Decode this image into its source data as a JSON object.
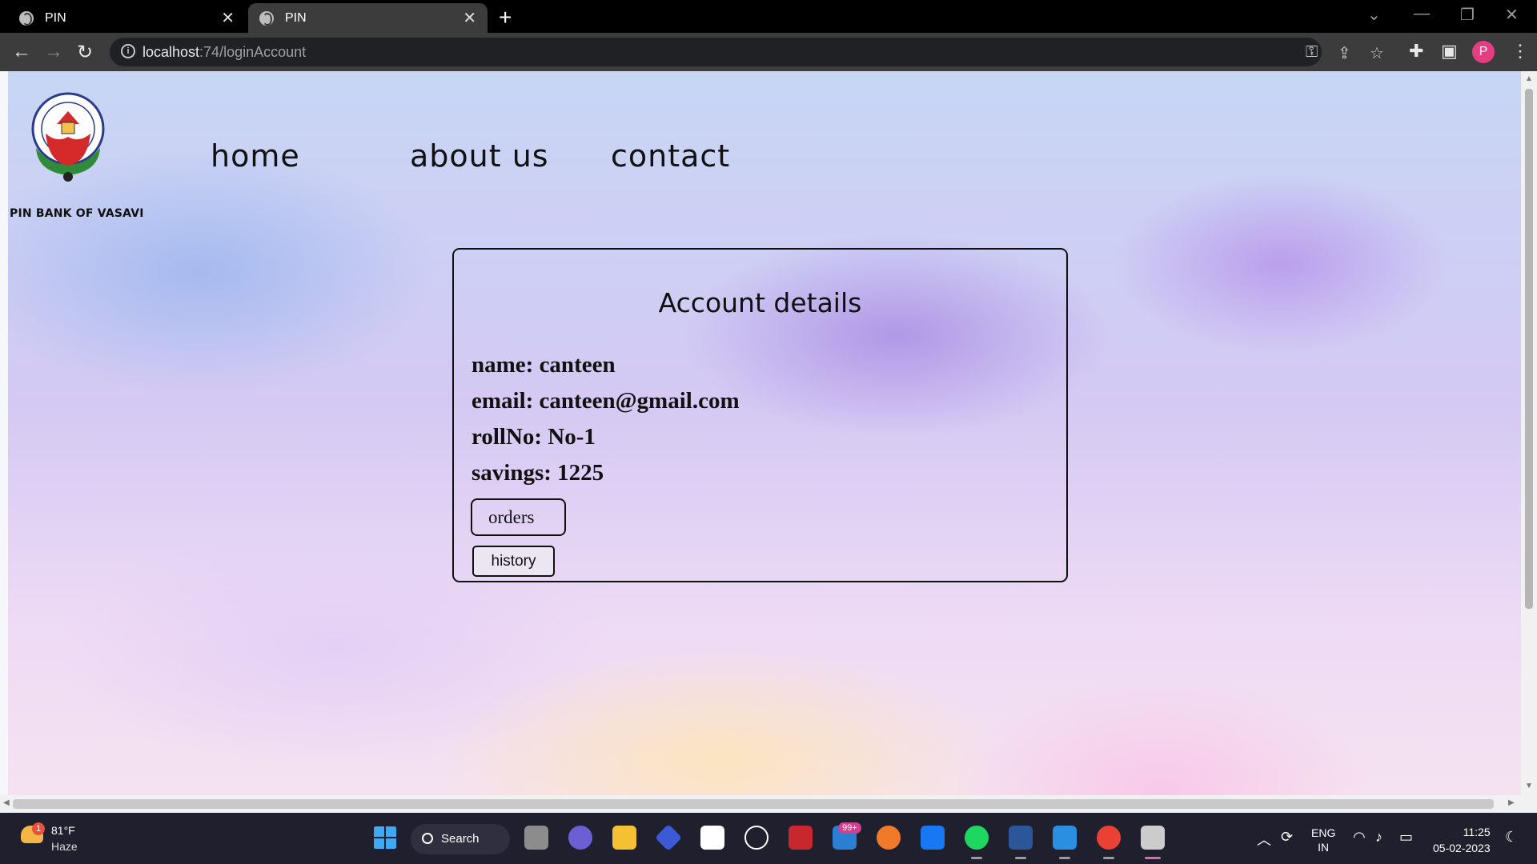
{
  "browser": {
    "tabs": [
      {
        "title": "PIN",
        "active": false
      },
      {
        "title": "PIN",
        "active": true
      }
    ],
    "url_host": "localhost",
    "url_path": ":74/loginAccount",
    "profile_initial": "P"
  },
  "site": {
    "brand": "PIN BANK OF VASAVI",
    "nav": [
      "home",
      "about us",
      "contact"
    ]
  },
  "account": {
    "title": "Account details",
    "fields": [
      {
        "label": "name: canteen"
      },
      {
        "label": "email: canteen@gmail.com"
      },
      {
        "label": "rollNo: No-1"
      },
      {
        "label": "savings: 1225"
      }
    ],
    "orders_label": "orders",
    "history_label": "history"
  },
  "taskbar": {
    "weather_temp": "81°F",
    "weather_cond": "Haze",
    "weather_badge": "1",
    "search_label": "Search",
    "notif_badge": "99+",
    "lang_line1": "ENG",
    "lang_line2": "IN",
    "time": "11:25",
    "date": "05-02-2023"
  }
}
